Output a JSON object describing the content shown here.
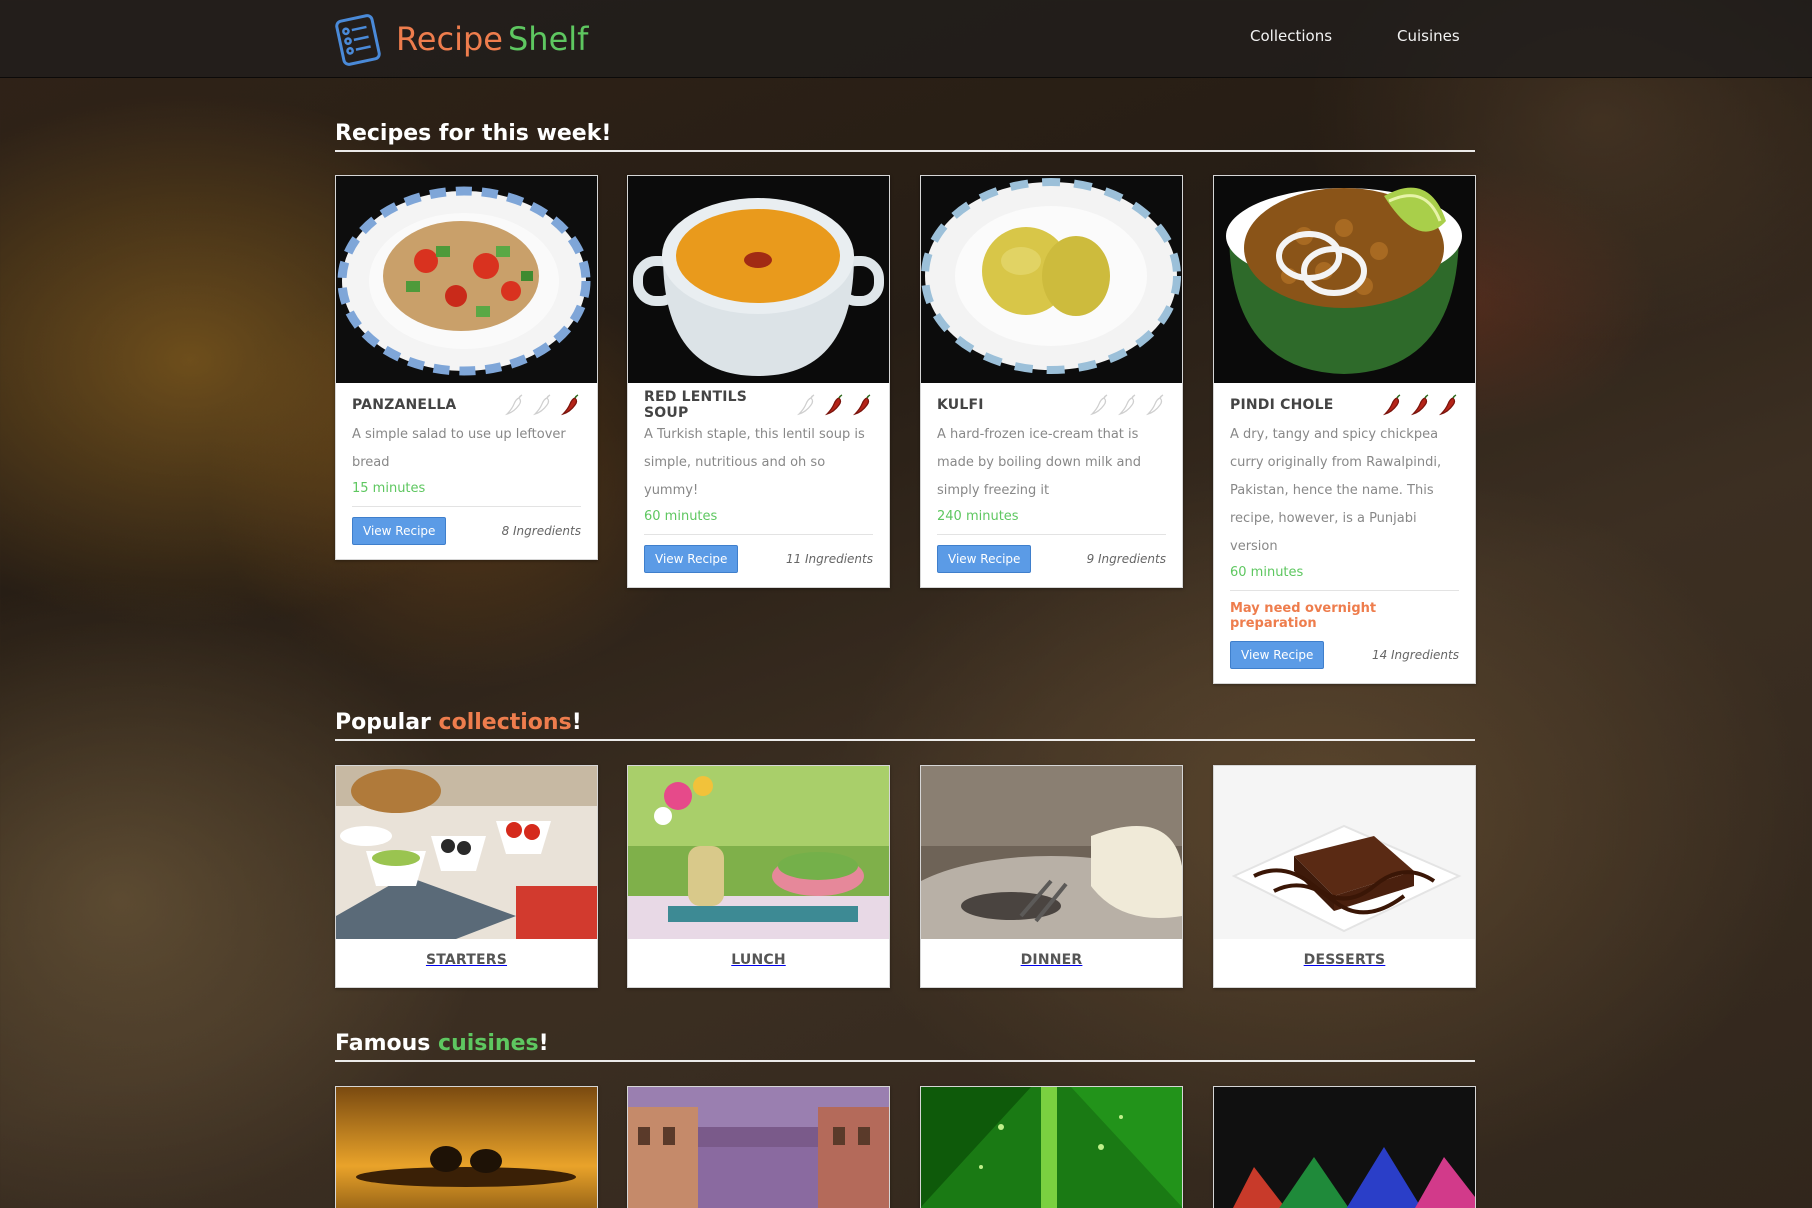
{
  "brand": {
    "part1": "Recipe",
    "part2": "Shelf",
    "icon": "recipe-list-icon"
  },
  "nav": {
    "collections": "Collections",
    "cuisines": "Cuisines"
  },
  "sections": {
    "recipes": {
      "title": "Recipes for this week!"
    },
    "collections": {
      "title_prefix": "Popular ",
      "title_accent": "collections",
      "title_suffix": "!"
    },
    "cuisines": {
      "title_prefix": "Famous ",
      "title_accent": "cuisines",
      "title_suffix": "!"
    }
  },
  "recipes": [
    {
      "name": "PANZANELLA",
      "spice_level": 1,
      "spice_max": 3,
      "description": "A simple salad to use up leftover bread",
      "time": "15 minutes",
      "warning": "",
      "button": "View Recipe",
      "ingredients": "8 Ingredients",
      "image": "salad-photo"
    },
    {
      "name": "RED LENTILS SOUP",
      "spice_level": 2,
      "spice_max": 3,
      "description": "A Turkish staple, this lentil soup is simple, nutritious and oh so yummy!",
      "time": "60 minutes",
      "warning": "",
      "button": "View Recipe",
      "ingredients": "11 Ingredients",
      "image": "soup-photo"
    },
    {
      "name": "KULFI",
      "spice_level": 0,
      "spice_max": 3,
      "description": "A hard-frozen ice-cream that is made by boiling down milk and simply freezing it",
      "time": "240 minutes",
      "warning": "",
      "button": "View Recipe",
      "ingredients": "9 Ingredients",
      "image": "kulfi-photo"
    },
    {
      "name": "PINDI CHOLE",
      "spice_level": 3,
      "spice_max": 3,
      "description": "A dry, tangy and spicy chickpea curry originally from Rawalpindi, Pakistan, hence the name. This recipe, however, is a Punjabi version",
      "time": "60 minutes",
      "warning": "May need overnight preparation",
      "button": "View Recipe",
      "ingredients": "14 Ingredients",
      "image": "chole-photo"
    }
  ],
  "collections": [
    {
      "label": "STARTERS",
      "image": "starters-photo"
    },
    {
      "label": "LUNCH",
      "image": "lunch-photo"
    },
    {
      "label": "DINNER",
      "image": "dinner-photo"
    },
    {
      "label": "DESSERTS",
      "image": "desserts-photo"
    }
  ],
  "cuisines": [
    {
      "image": "africa-elephants-photo"
    },
    {
      "image": "venice-canal-photo"
    },
    {
      "image": "green-leaf-photo"
    },
    {
      "image": "colored-powder-photo"
    }
  ],
  "colors": {
    "accent_orange": "#ee7d4d",
    "accent_green": "#5ec760",
    "button_blue": "#5b9be6",
    "chili_red": "#b52418"
  }
}
